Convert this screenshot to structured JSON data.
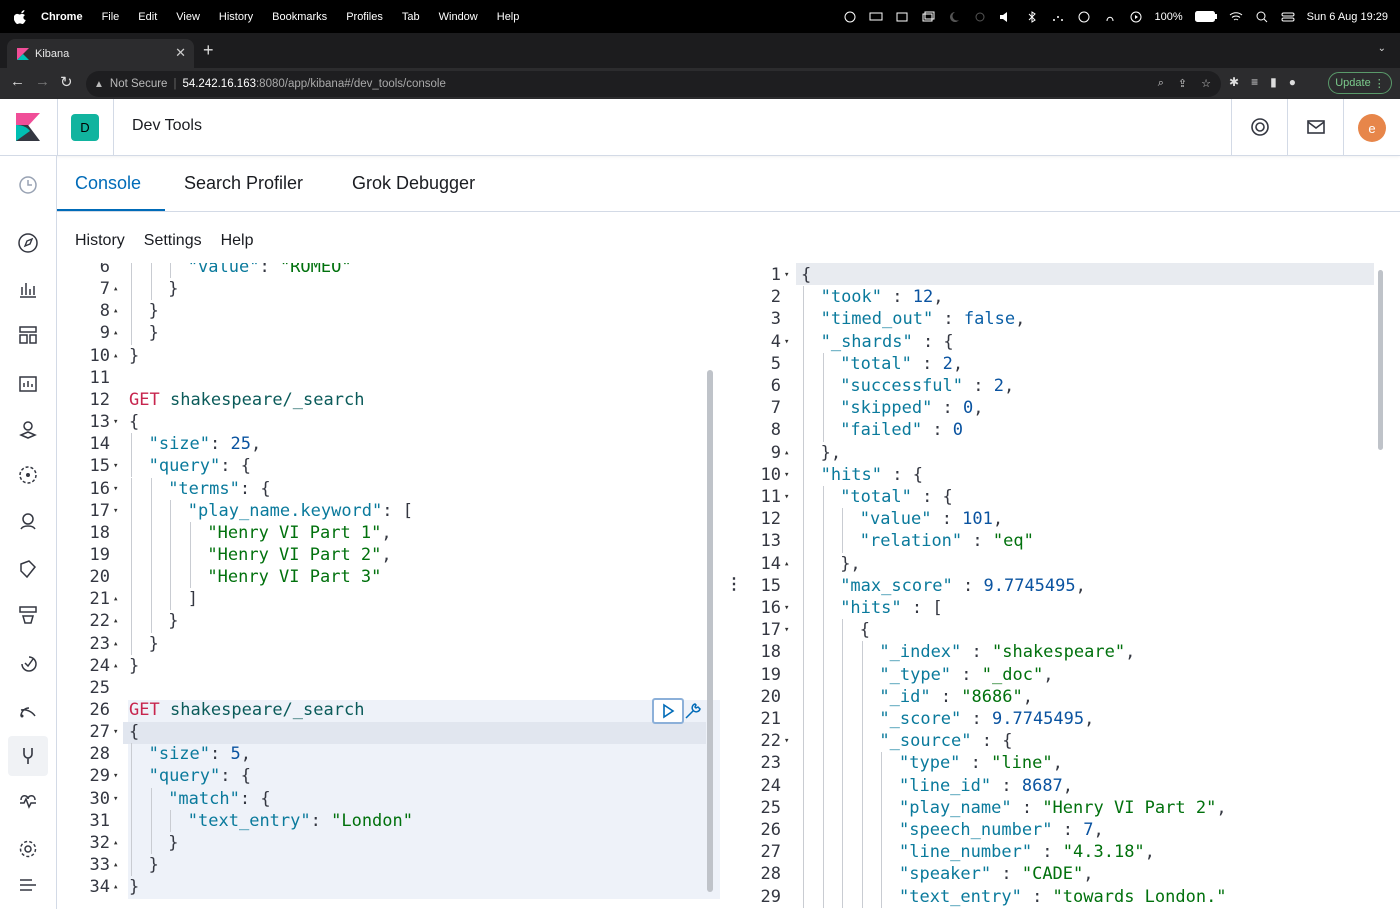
{
  "menubar": {
    "app": "Chrome",
    "items": [
      "File",
      "Edit",
      "View",
      "History",
      "Bookmarks",
      "Profiles",
      "Tab",
      "Window",
      "Help"
    ],
    "battery": "100%",
    "datetime": "Sun 6 Aug  19:29"
  },
  "browser": {
    "tab_title": "Kibana",
    "security": "Not Secure",
    "url_host": "54.242.16.163",
    "url_rest": ":8080/app/kibana#/dev_tools/console",
    "update_label": "Update"
  },
  "header": {
    "space_initial": "D",
    "title": "Dev Tools",
    "user_initial": "e"
  },
  "tabs": [
    "Console",
    "Search Profiler",
    "Grok Debugger"
  ],
  "subnav": [
    "History",
    "Settings",
    "Help"
  ],
  "request_lines": [
    {
      "n": "6",
      "fold": "",
      "depth": 3,
      "html": "<span class='k'>\"value\"</span>: <span class='s'>\"ROMEO\"</span>"
    },
    {
      "n": "7",
      "fold": "▴",
      "depth": 2,
      "html": "}"
    },
    {
      "n": "8",
      "fold": "▴",
      "depth": 1,
      "html": "}"
    },
    {
      "n": "9",
      "fold": "▴",
      "depth": 1,
      "html": "}"
    },
    {
      "n": "10",
      "fold": "▴",
      "depth": 0,
      "html": "}"
    },
    {
      "n": "11",
      "fold": "",
      "depth": 0,
      "html": ""
    },
    {
      "n": "12",
      "fold": "",
      "depth": 0,
      "html": "<span class='m'>GET</span> <span class='u'>shakespeare/_search</span>"
    },
    {
      "n": "13",
      "fold": "▾",
      "depth": 0,
      "html": "{"
    },
    {
      "n": "14",
      "fold": "",
      "depth": 1,
      "html": "<span class='k'>\"size\"</span>: <span class='n'>25</span>,"
    },
    {
      "n": "15",
      "fold": "▾",
      "depth": 1,
      "html": "<span class='k'>\"query\"</span>: {"
    },
    {
      "n": "16",
      "fold": "▾",
      "depth": 2,
      "html": "<span class='k'>\"terms\"</span>: {"
    },
    {
      "n": "17",
      "fold": "▾",
      "depth": 3,
      "html": "<span class='k'>\"play_name.keyword\"</span>: ["
    },
    {
      "n": "18",
      "fold": "",
      "depth": 4,
      "html": "<span class='s'>\"Henry VI Part 1\"</span>,"
    },
    {
      "n": "19",
      "fold": "",
      "depth": 4,
      "html": "<span class='s'>\"Henry VI Part 2\"</span>,"
    },
    {
      "n": "20",
      "fold": "",
      "depth": 4,
      "html": "<span class='s'>\"Henry VI Part 3\"</span>"
    },
    {
      "n": "21",
      "fold": "▴",
      "depth": 3,
      "html": "]"
    },
    {
      "n": "22",
      "fold": "▴",
      "depth": 2,
      "html": "}"
    },
    {
      "n": "23",
      "fold": "▴",
      "depth": 1,
      "html": "}"
    },
    {
      "n": "24",
      "fold": "▴",
      "depth": 0,
      "html": "}"
    },
    {
      "n": "25",
      "fold": "",
      "depth": 0,
      "html": ""
    },
    {
      "n": "26",
      "fold": "",
      "depth": 0,
      "html": "<span class='m'>GET</span> <span class='u'>shakespeare/_search</span>"
    },
    {
      "n": "27",
      "fold": "▾",
      "depth": 0,
      "html": "{"
    },
    {
      "n": "28",
      "fold": "",
      "depth": 1,
      "html": "<span class='k'>\"size\"</span>: <span class='n'>5</span>,"
    },
    {
      "n": "29",
      "fold": "▾",
      "depth": 1,
      "html": "<span class='k'>\"query\"</span>: {"
    },
    {
      "n": "30",
      "fold": "▾",
      "depth": 2,
      "html": "<span class='k'>\"match\"</span>: {"
    },
    {
      "n": "31",
      "fold": "",
      "depth": 3,
      "html": "<span class='k'>\"text_entry\"</span>: <span class='s'>\"London\"</span>"
    },
    {
      "n": "32",
      "fold": "▴",
      "depth": 2,
      "html": "}"
    },
    {
      "n": "33",
      "fold": "▴",
      "depth": 1,
      "html": "}"
    },
    {
      "n": "34",
      "fold": "▴",
      "depth": 0,
      "html": "}"
    }
  ],
  "response_lines": [
    {
      "n": "1",
      "fold": "▾",
      "depth": 0,
      "html": "{"
    },
    {
      "n": "2",
      "fold": "",
      "depth": 1,
      "html": "<span class='k'>\"took\"</span> : <span class='n'>12</span>,"
    },
    {
      "n": "3",
      "fold": "",
      "depth": 1,
      "html": "<span class='k'>\"timed_out\"</span> : <span class='b'>false</span>,"
    },
    {
      "n": "4",
      "fold": "▾",
      "depth": 1,
      "html": "<span class='k'>\"_shards\"</span> : {"
    },
    {
      "n": "5",
      "fold": "",
      "depth": 2,
      "html": "<span class='k'>\"total\"</span> : <span class='n'>2</span>,"
    },
    {
      "n": "6",
      "fold": "",
      "depth": 2,
      "html": "<span class='k'>\"successful\"</span> : <span class='n'>2</span>,"
    },
    {
      "n": "7",
      "fold": "",
      "depth": 2,
      "html": "<span class='k'>\"skipped\"</span> : <span class='n'>0</span>,"
    },
    {
      "n": "8",
      "fold": "",
      "depth": 2,
      "html": "<span class='k'>\"failed\"</span> : <span class='n'>0</span>"
    },
    {
      "n": "9",
      "fold": "▴",
      "depth": 1,
      "html": "},"
    },
    {
      "n": "10",
      "fold": "▾",
      "depth": 1,
      "html": "<span class='k'>\"hits\"</span> : {"
    },
    {
      "n": "11",
      "fold": "▾",
      "depth": 2,
      "html": "<span class='k'>\"total\"</span> : {"
    },
    {
      "n": "12",
      "fold": "",
      "depth": 3,
      "html": "<span class='k'>\"value\"</span> : <span class='n'>101</span>,"
    },
    {
      "n": "13",
      "fold": "",
      "depth": 3,
      "html": "<span class='k'>\"relation\"</span> : <span class='s'>\"eq\"</span>"
    },
    {
      "n": "14",
      "fold": "▴",
      "depth": 2,
      "html": "},"
    },
    {
      "n": "15",
      "fold": "",
      "depth": 2,
      "html": "<span class='k'>\"max_score\"</span> : <span class='n'>9.7745495</span>,"
    },
    {
      "n": "16",
      "fold": "▾",
      "depth": 2,
      "html": "<span class='k'>\"hits\"</span> : ["
    },
    {
      "n": "17",
      "fold": "▾",
      "depth": 3,
      "html": "{"
    },
    {
      "n": "18",
      "fold": "",
      "depth": 4,
      "html": "<span class='k'>\"_index\"</span> : <span class='s'>\"shakespeare\"</span>,"
    },
    {
      "n": "19",
      "fold": "",
      "depth": 4,
      "html": "<span class='k'>\"_type\"</span> : <span class='s'>\"_doc\"</span>,"
    },
    {
      "n": "20",
      "fold": "",
      "depth": 4,
      "html": "<span class='k'>\"_id\"</span> : <span class='s'>\"8686\"</span>,"
    },
    {
      "n": "21",
      "fold": "",
      "depth": 4,
      "html": "<span class='k'>\"_score\"</span> : <span class='n'>9.7745495</span>,"
    },
    {
      "n": "22",
      "fold": "▾",
      "depth": 4,
      "html": "<span class='k'>\"_source\"</span> : {"
    },
    {
      "n": "23",
      "fold": "",
      "depth": 5,
      "html": "<span class='k'>\"type\"</span> : <span class='s'>\"line\"</span>,"
    },
    {
      "n": "24",
      "fold": "",
      "depth": 5,
      "html": "<span class='k'>\"line_id\"</span> : <span class='n'>8687</span>,"
    },
    {
      "n": "25",
      "fold": "",
      "depth": 5,
      "html": "<span class='k'>\"play_name\"</span> : <span class='s'>\"Henry VI Part 2\"</span>,"
    },
    {
      "n": "26",
      "fold": "",
      "depth": 5,
      "html": "<span class='k'>\"speech_number\"</span> : <span class='n'>7</span>,"
    },
    {
      "n": "27",
      "fold": "",
      "depth": 5,
      "html": "<span class='k'>\"line_number\"</span> : <span class='s'>\"4.3.18\"</span>,"
    },
    {
      "n": "28",
      "fold": "",
      "depth": 5,
      "html": "<span class='k'>\"speaker\"</span> : <span class='s'>\"CADE\"</span>,"
    },
    {
      "n": "29",
      "fold": "",
      "depth": 5,
      "html": "<span class='k'>\"text_entry\"</span> : <span class='s'>\"towards London.\"</span>"
    }
  ]
}
